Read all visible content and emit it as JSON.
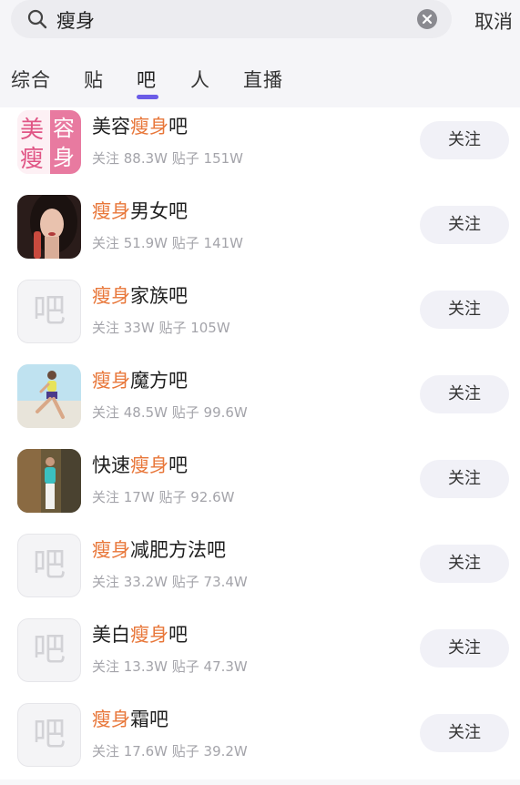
{
  "search": {
    "query": "瘦身",
    "cancel_label": "取消"
  },
  "tabs": [
    {
      "label": "综合"
    },
    {
      "label": "贴"
    },
    {
      "label": "吧"
    },
    {
      "label": "人"
    },
    {
      "label": "直播"
    }
  ],
  "active_tab": "吧",
  "placeholder_char": "吧",
  "results": [
    {
      "pre": "美容",
      "hl": "瘦身",
      "post": "吧",
      "stats": "关注 88.3W 贴子 151W",
      "follow": "关注",
      "avatar": "beauty-logo"
    },
    {
      "pre": "",
      "hl": "瘦身",
      "post": "男女吧",
      "stats": "关注 51.9W 贴子 141W",
      "follow": "关注",
      "avatar": "portrait-photo"
    },
    {
      "pre": "",
      "hl": "瘦身",
      "post": "家族吧",
      "stats": "关注 33W 贴子 105W",
      "follow": "关注",
      "avatar": "placeholder"
    },
    {
      "pre": "",
      "hl": "瘦身",
      "post": "魔方吧",
      "stats": "关注 48.5W 贴子 99.6W",
      "follow": "关注",
      "avatar": "runner-photo"
    },
    {
      "pre": "快速",
      "hl": "瘦身",
      "post": "吧",
      "stats": "关注 17W 贴子 92.6W",
      "follow": "关注",
      "avatar": "standing-photo"
    },
    {
      "pre": "",
      "hl": "瘦身",
      "post": "减肥方法吧",
      "stats": "关注 33.2W 贴子 73.4W",
      "follow": "关注",
      "avatar": "placeholder"
    },
    {
      "pre": "美白",
      "hl": "瘦身",
      "post": "吧",
      "stats": "关注 13.3W 贴子 47.3W",
      "follow": "关注",
      "avatar": "placeholder"
    },
    {
      "pre": "",
      "hl": "瘦身",
      "post": "霜吧",
      "stats": "关注 17.6W 贴子 39.2W",
      "follow": "关注",
      "avatar": "placeholder"
    }
  ],
  "beauty_logo": {
    "chars": [
      "美",
      "容",
      "瘦",
      "身"
    ]
  },
  "colors": {
    "highlight": "#e8773a",
    "accent": "#6b5ce7",
    "logo_pink": "#e05585"
  }
}
